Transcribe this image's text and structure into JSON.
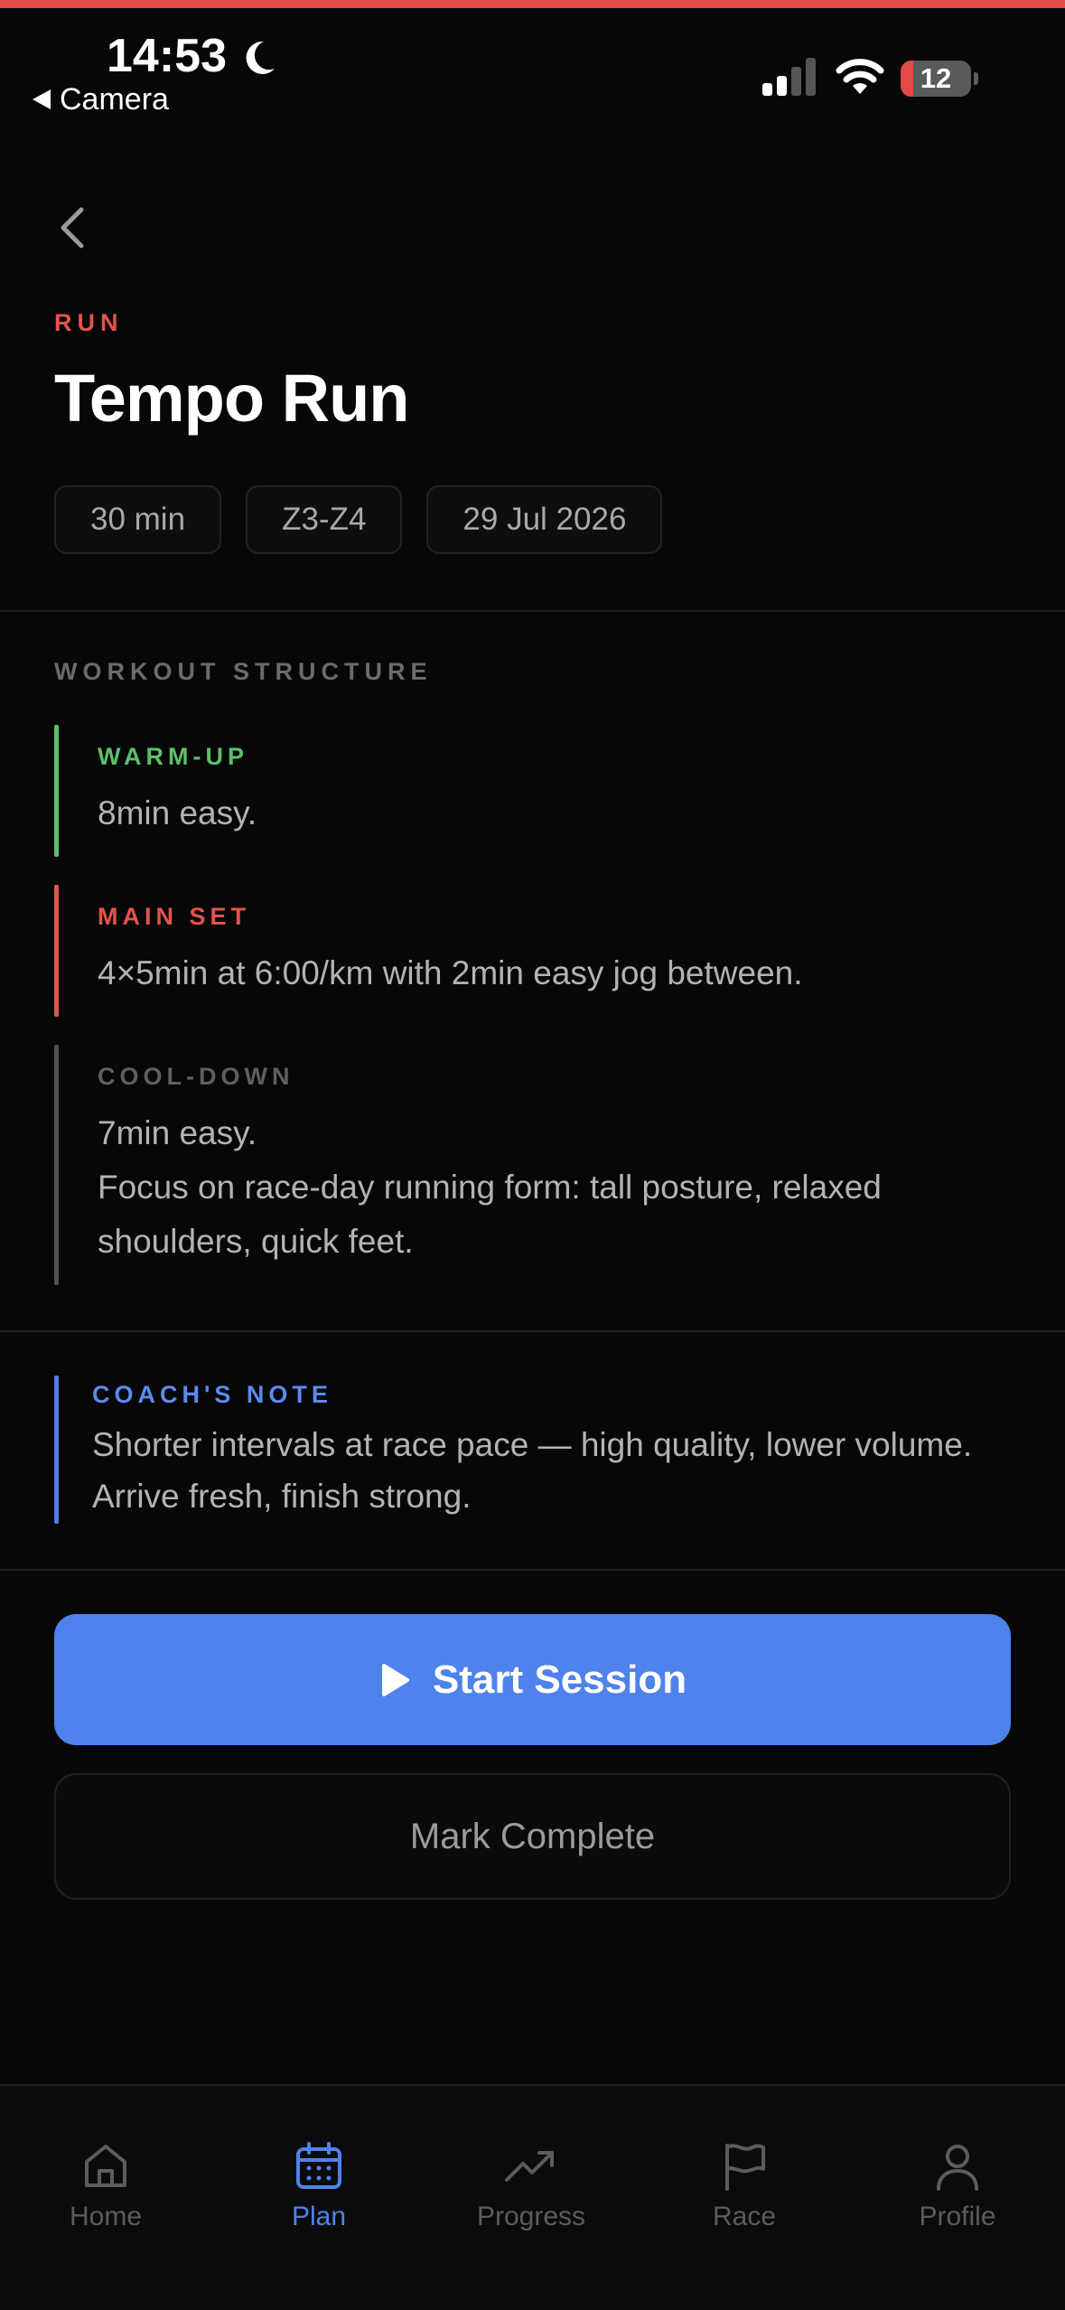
{
  "status_bar": {
    "time": "14:53",
    "back_app": "Camera",
    "battery_level": "12"
  },
  "workout": {
    "category": "RUN",
    "title": "Tempo Run",
    "chips": [
      "30 min",
      "Z3-Z4",
      "29 Jul 2026"
    ]
  },
  "structure": {
    "heading": "WORKOUT STRUCTURE",
    "warmup": {
      "label": "WARM-UP",
      "text": "8min easy.",
      "color": "#5cbf6a"
    },
    "main_set": {
      "label": "MAIN SET",
      "text": "4×5min at 6:00/km with 2min easy jog between.",
      "color": "#e5534b"
    },
    "cooldown": {
      "label": "COOL-DOWN",
      "text_line1": "7min easy.",
      "text_line2": "Focus on race-day running form: tall posture, relaxed shoulders, quick feet.",
      "color": "#505050"
    }
  },
  "coach_note": {
    "label": "COACH'S NOTE",
    "text": "Shorter intervals at race pace — high quality, lower volume. Arrive fresh, finish strong.",
    "color": "#4f7fe8"
  },
  "actions": {
    "primary": "Start Session",
    "secondary": "Mark Complete",
    "accent": "#4f82ec"
  },
  "tabs": [
    {
      "label": "Home",
      "icon": "home-icon",
      "active": false
    },
    {
      "label": "Plan",
      "icon": "calendar-icon",
      "active": true
    },
    {
      "label": "Progress",
      "icon": "trending-up-icon",
      "active": false
    },
    {
      "label": "Race",
      "icon": "flag-icon",
      "active": false
    },
    {
      "label": "Profile",
      "icon": "user-icon",
      "active": false
    }
  ]
}
